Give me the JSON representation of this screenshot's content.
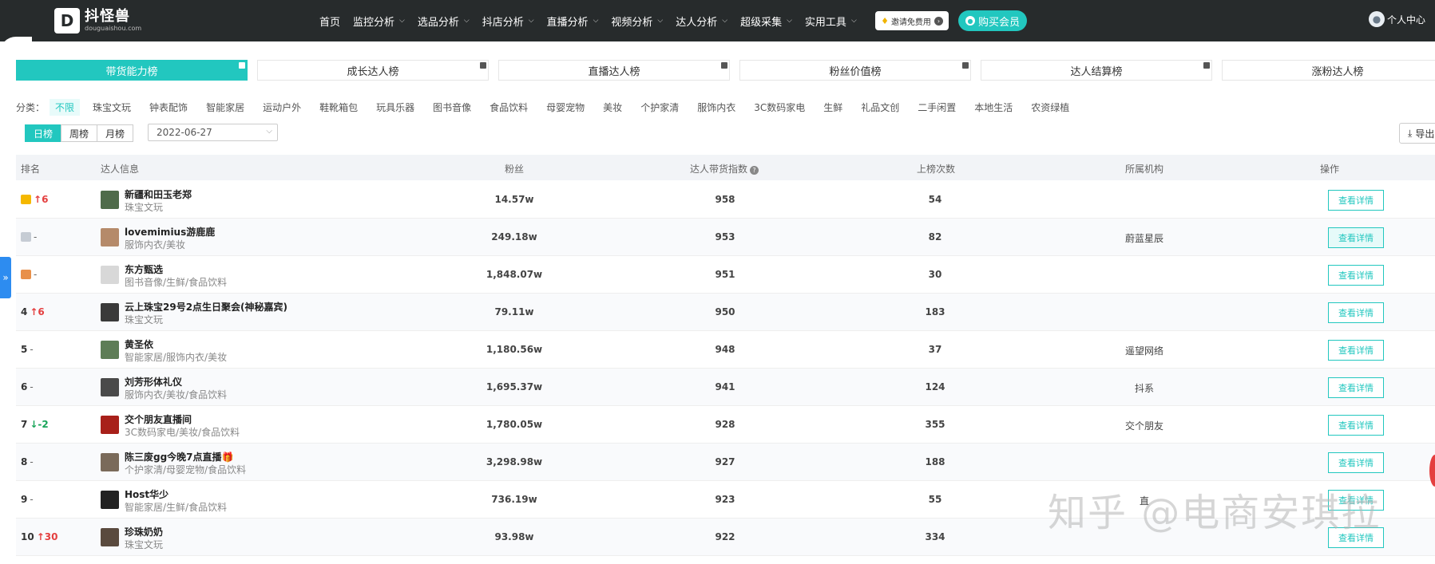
{
  "header": {
    "logo_name": "抖怪兽",
    "logo_sub": "douguaishou.com",
    "nav": [
      {
        "label": "首页",
        "dropdown": false
      },
      {
        "label": "监控分析",
        "dropdown": true
      },
      {
        "label": "选品分析",
        "dropdown": true
      },
      {
        "label": "抖店分析",
        "dropdown": true
      },
      {
        "label": "直播分析",
        "dropdown": true
      },
      {
        "label": "视频分析",
        "dropdown": true
      },
      {
        "label": "达人分析",
        "dropdown": true
      },
      {
        "label": "超级采集",
        "dropdown": true
      },
      {
        "label": "实用工具",
        "dropdown": true
      }
    ],
    "invite_label": "邀请免费用",
    "buy_label": "购买会员",
    "user_label": "个人中心"
  },
  "tabs": [
    {
      "label": "带货能力榜",
      "active": true
    },
    {
      "label": "成长达人榜",
      "active": false
    },
    {
      "label": "直播达人榜",
      "active": false
    },
    {
      "label": "粉丝价值榜",
      "active": false
    },
    {
      "label": "达人结算榜",
      "active": false
    },
    {
      "label": "涨粉达人榜",
      "active": false
    }
  ],
  "categories": {
    "label": "分类：",
    "items": [
      "不限",
      "珠宝文玩",
      "钟表配饰",
      "智能家居",
      "运动户外",
      "鞋靴箱包",
      "玩具乐器",
      "图书音像",
      "食品饮料",
      "母婴宠物",
      "美妆",
      "个护家清",
      "服饰内衣",
      "3C数码家电",
      "生鲜",
      "礼品文创",
      "二手闲置",
      "本地生活",
      "农资绿植"
    ],
    "active_index": 0
  },
  "periods": [
    {
      "label": "日榜",
      "active": true
    },
    {
      "label": "周榜",
      "active": false
    },
    {
      "label": "月榜",
      "active": false
    }
  ],
  "date_value": "2022-06-27",
  "export_label": "导出",
  "table": {
    "headers": {
      "rank": "排名",
      "info": "达人信息",
      "fans": "粉丝",
      "index": "达人带货指数",
      "count": "上榜次数",
      "org": "所属机构",
      "action": "操作"
    },
    "button_label": "查看详情",
    "rows": [
      {
        "rank": "",
        "crown": "#f5b800",
        "dir": "up",
        "change": "6",
        "name": "新疆和田玉老郑",
        "cat": "珠宝文玩",
        "fans": "14.57w",
        "index": "958",
        "count": "54",
        "org": "",
        "avatar": "#4f6b4a"
      },
      {
        "rank": "",
        "crown": "#c6ccd4",
        "dir": "none",
        "change": "-",
        "name": "lovemimius游鹿鹿",
        "cat": "服饰内衣/美妆",
        "fans": "249.18w",
        "index": "953",
        "count": "82",
        "org": "蔚蓝星辰",
        "avatar": "#b58a6a"
      },
      {
        "rank": "",
        "crown": "#e8904a",
        "dir": "none",
        "change": "-",
        "name": "东方甄选",
        "cat": "图书音像/生鲜/食品饮料",
        "fans": "1,848.07w",
        "index": "951",
        "count": "30",
        "org": "",
        "avatar": "#d8d8d8"
      },
      {
        "rank": "4",
        "crown": "",
        "dir": "up",
        "change": "6",
        "name": "云上珠宝29号2点生日聚会(神秘嘉宾)",
        "cat": "珠宝文玩",
        "fans": "79.11w",
        "index": "950",
        "count": "183",
        "org": "",
        "avatar": "#3a3a3a"
      },
      {
        "rank": "5",
        "crown": "",
        "dir": "none",
        "change": "-",
        "name": "黄圣依",
        "cat": "智能家居/服饰内衣/美妆",
        "fans": "1,180.56w",
        "index": "948",
        "count": "37",
        "org": "遥望网络",
        "avatar": "#5e7d56"
      },
      {
        "rank": "6",
        "crown": "",
        "dir": "none",
        "change": "-",
        "name": "刘芳形体礼仪",
        "cat": "服饰内衣/美妆/食品饮料",
        "fans": "1,695.37w",
        "index": "941",
        "count": "124",
        "org": "抖系",
        "avatar": "#4a4a4a"
      },
      {
        "rank": "7",
        "crown": "",
        "dir": "down",
        "change": "-2",
        "name": "交个朋友直播间",
        "cat": "3C数码家电/美妆/食品饮料",
        "fans": "1,780.05w",
        "index": "928",
        "count": "355",
        "org": "交个朋友",
        "avatar": "#a8201a"
      },
      {
        "rank": "8",
        "crown": "",
        "dir": "none",
        "change": "-",
        "name": "陈三废gg今晚7点直播🎁",
        "cat": "个护家清/母婴宠物/食品饮料",
        "fans": "3,298.98w",
        "index": "927",
        "count": "188",
        "org": "",
        "avatar": "#7a6a5a"
      },
      {
        "rank": "9",
        "crown": "",
        "dir": "none",
        "change": "-",
        "name": "Host华少",
        "cat": "智能家居/生鲜/食品饮料",
        "fans": "736.19w",
        "index": "923",
        "count": "55",
        "org": "直",
        "avatar": "#222222"
      },
      {
        "rank": "10",
        "crown": "",
        "dir": "up",
        "change": "30",
        "name": "珍珠奶奶",
        "cat": "珠宝文玩",
        "fans": "93.98w",
        "index": "922",
        "count": "334",
        "org": "",
        "avatar": "#5a4a3e"
      }
    ]
  },
  "watermark": "知乎 @电商安琪拉",
  "colors": {
    "accent": "#22c7bf",
    "nav_bg": "#272b2c",
    "up": "#e43f3f",
    "down": "#19a55a",
    "side_toggle": "#2d8cf0"
  }
}
